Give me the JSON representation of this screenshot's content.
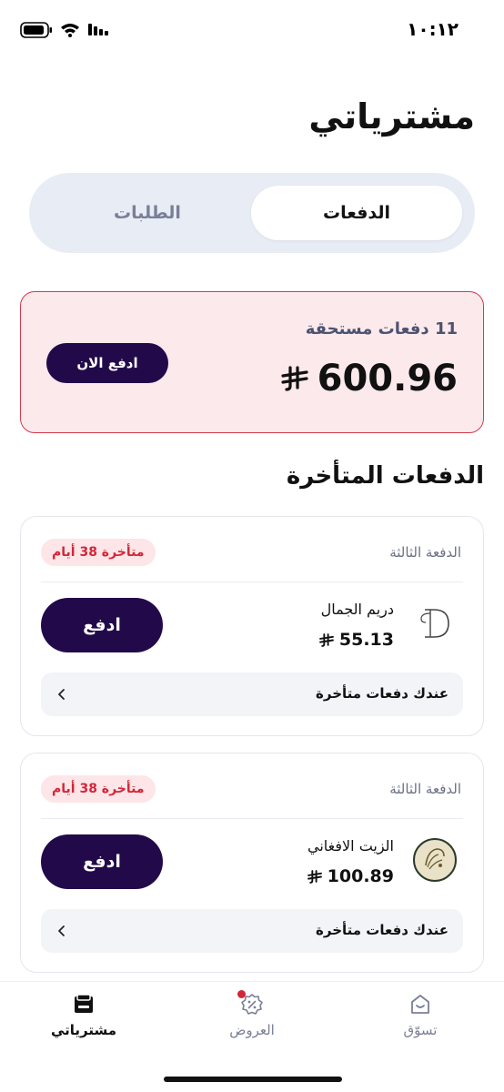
{
  "status_bar": {
    "time": "١٠:١٢"
  },
  "header": {
    "title": "مشترياتي"
  },
  "tabs": [
    {
      "label": "الدفعات",
      "active": true
    },
    {
      "label": "الطلبات",
      "active": false
    }
  ],
  "due_summary": {
    "count_label": "11 دفعات مستحقة",
    "amount": "600.96",
    "pay_now_label": "ادفع الان"
  },
  "late_section": {
    "title": "الدفعات المتأخرة"
  },
  "late_payments": [
    {
      "installment": "الدفعة الثالثة",
      "late_badge": "متأخرة 38 أيام",
      "merchant": "دريم الجمال",
      "amount": "55.13",
      "pay_label": "ادفع",
      "late_row_label": "عندك دفعات متأخرة",
      "logo_icon": "dream-beauty-logo-icon"
    },
    {
      "installment": "الدفعة الثالثة",
      "late_badge": "متأخرة 38 أيام",
      "merchant": "الزيت الافغاني",
      "amount": "100.89",
      "pay_label": "ادفع",
      "late_row_label": "عندك دفعات متأخرة",
      "logo_icon": "afghan-oil-logo-icon"
    }
  ],
  "bottom_nav": [
    {
      "label": "مشترياتي",
      "icon": "purchases-icon",
      "active": true
    },
    {
      "label": "العروض",
      "icon": "offers-icon",
      "active": false,
      "has_badge": true
    },
    {
      "label": "تسوّق",
      "icon": "shop-icon",
      "active": false
    }
  ],
  "colors": {
    "primary": "#220a4a",
    "alert_red": "#d32638",
    "alert_bg": "#fbe9ec",
    "tab_bg": "#e8ecf5"
  }
}
